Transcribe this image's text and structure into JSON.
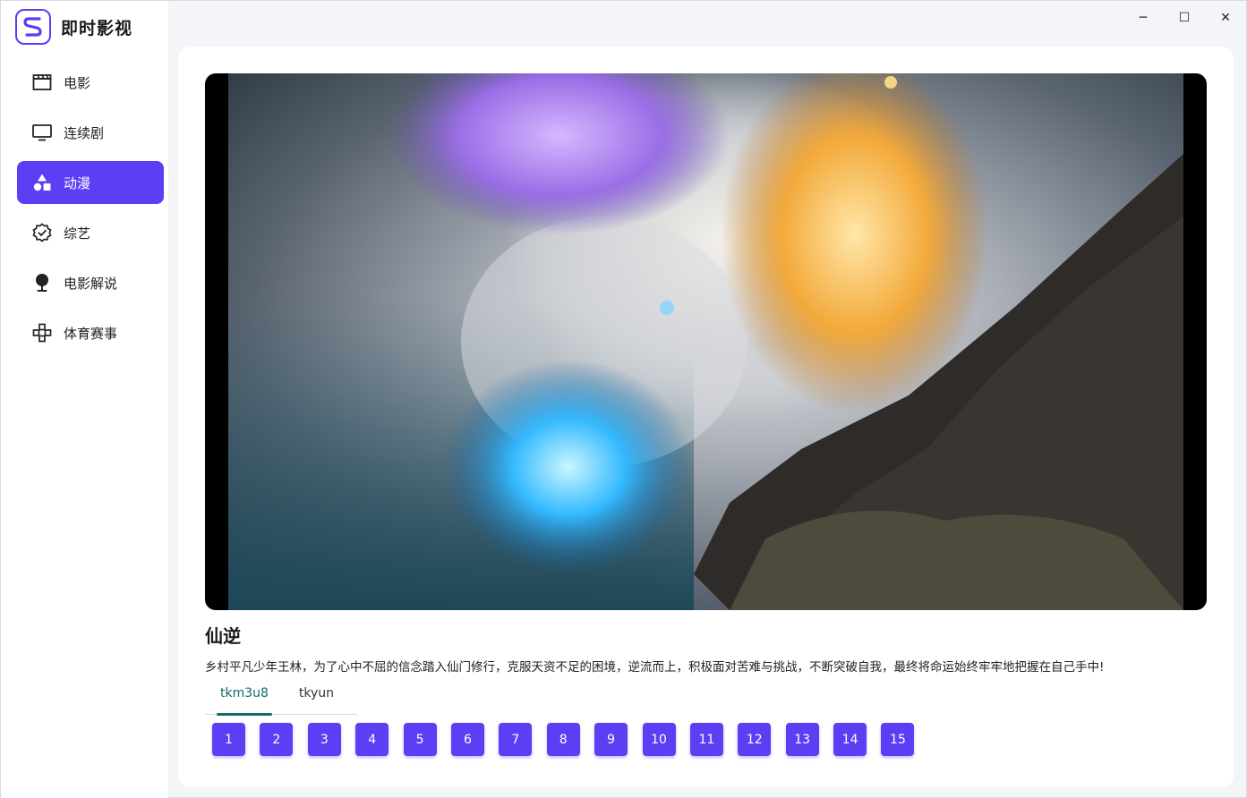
{
  "app": {
    "title": "即时影视",
    "accent_color": "#5a3ff5",
    "tab_active_color": "#0e6b66"
  },
  "window_controls": {
    "minimize": "─",
    "maximize": "☐",
    "close": "✕"
  },
  "sidebar": {
    "items": [
      {
        "label": "电影",
        "icon": "clapperboard-icon",
        "active": false
      },
      {
        "label": "连续剧",
        "icon": "monitor-icon",
        "active": false
      },
      {
        "label": "动漫",
        "icon": "shapes-icon",
        "active": true
      },
      {
        "label": "综艺",
        "icon": "badge-check-icon",
        "active": false
      },
      {
        "label": "电影解说",
        "icon": "microphone-icon",
        "active": false
      },
      {
        "label": "体育赛事",
        "icon": "gamepad-icon",
        "active": false
      }
    ]
  },
  "detail": {
    "title": "仙逆",
    "description": "乡村平凡少年王林，为了心中不屈的信念踏入仙门修行，克服天资不足的困境，逆流而上，积极面对苦难与挑战，不断突破自我，最终将命运始终牢牢地把握在自己手中!",
    "sources": [
      {
        "label": "tkm3u8",
        "active": true
      },
      {
        "label": "tkyun",
        "active": false
      }
    ],
    "episodes": [
      "1",
      "2",
      "3",
      "4",
      "5",
      "6",
      "7",
      "8",
      "9",
      "10",
      "11",
      "12",
      "13",
      "14",
      "15"
    ]
  }
}
